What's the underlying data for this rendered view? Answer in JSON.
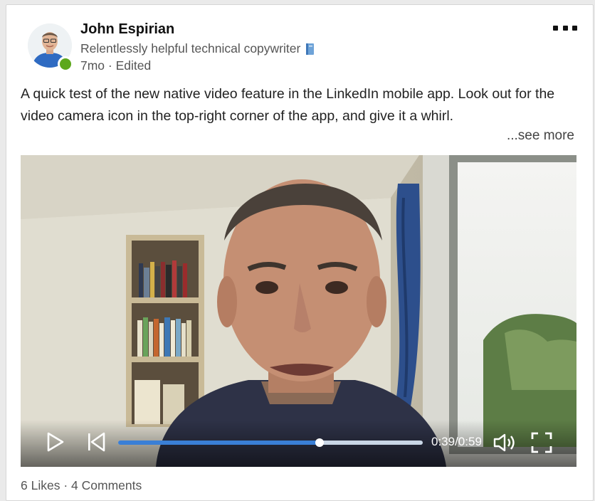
{
  "post": {
    "author": {
      "name": "John Espirian",
      "headline": "Relentlessly helpful technical copywriter",
      "headline_icon": "blue-book-icon",
      "age": "7mo",
      "separator": "·",
      "status": "Edited",
      "online": true
    },
    "menu_icon": "more-dots-icon",
    "text": "A quick test of the new native video feature in the LinkedIn mobile app. Look out for the video camera icon in the top-right corner of the app, and give it a whirl.",
    "see_more": "...see more",
    "video": {
      "time": "0:39/0:59",
      "progress": 0.661,
      "icons": [
        "play-icon",
        "rewind-icon",
        "volume-icon",
        "fullscreen-icon"
      ]
    },
    "social": {
      "likes": "6 Likes",
      "separator": "·",
      "comments": "4 Comments"
    }
  },
  "colors": {
    "accent": "#3a7fd6",
    "presence": "#5ca71b",
    "muted_text": "#555555"
  }
}
